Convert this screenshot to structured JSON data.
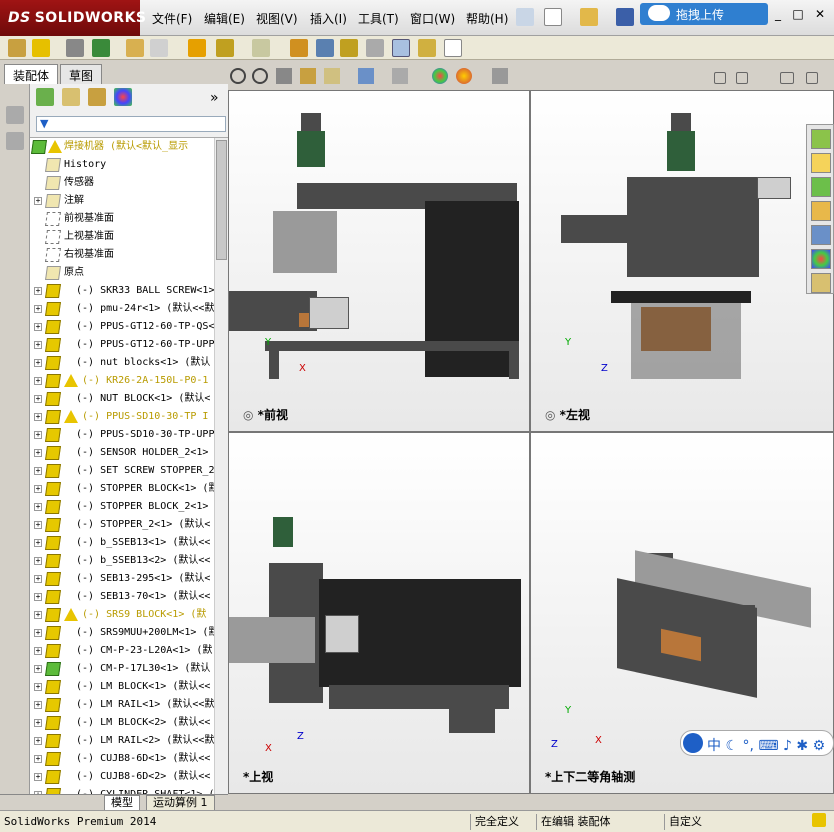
{
  "app": {
    "logo": "SOLIDWORKS",
    "logo_prefix": "DS"
  },
  "menu": [
    {
      "label": "文件(F)"
    },
    {
      "label": "编辑(E)"
    },
    {
      "label": "视图(V)"
    },
    {
      "label": "插入(I)"
    },
    {
      "label": "工具(T)"
    },
    {
      "label": "窗口(W)"
    },
    {
      "label": "帮助(H)"
    }
  ],
  "upload_label": "拖拽上传",
  "panel_tabs": [
    "装配体",
    "草图"
  ],
  "tree": {
    "root": "焊接机器  (默认<默认_显示",
    "nodes": [
      {
        "label": "History",
        "type": "history"
      },
      {
        "label": "传感器",
        "type": "sensor"
      },
      {
        "label": "注解",
        "type": "annot"
      },
      {
        "label": "前视基准面",
        "type": "plane"
      },
      {
        "label": "上视基准面",
        "type": "plane"
      },
      {
        "label": "右视基准面",
        "type": "plane"
      },
      {
        "label": "原点",
        "type": "origin"
      },
      {
        "label": "(-) SKR33 BALL SCREW<1>",
        "type": "part",
        "warn": false
      },
      {
        "label": "(-) pmu-24r<1> (默认<<默",
        "type": "part",
        "warn": false
      },
      {
        "label": "(-) PPUS-GT12-60-TP-QS<",
        "type": "part",
        "warn": false
      },
      {
        "label": "(-) PPUS-GT12-60-TP-UPPI",
        "type": "part",
        "warn": false
      },
      {
        "label": "(-) nut blocks<1> (默认",
        "type": "part",
        "warn": false
      },
      {
        "label": "(-) KR26-2A-150L-P0-1",
        "type": "part",
        "warn": true
      },
      {
        "label": "(-) NUT BLOCK<1> (默认<",
        "type": "part",
        "warn": false
      },
      {
        "label": "(-) PPUS-SD10-30-TP I",
        "type": "part",
        "warn": true
      },
      {
        "label": "(-) PPUS-SD10-30-TP-UPPI",
        "type": "part",
        "warn": false
      },
      {
        "label": "(-) SENSOR HOLDER_2<1>",
        "type": "part",
        "warn": false
      },
      {
        "label": "(-) SET SCREW STOPPER_2",
        "type": "part",
        "warn": false
      },
      {
        "label": "(-) STOPPER BLOCK<1> (默",
        "type": "part",
        "warn": false
      },
      {
        "label": "(-) STOPPER BLOCK_2<1>",
        "type": "part",
        "warn": false
      },
      {
        "label": "(-) STOPPER_2<1> (默认<",
        "type": "part",
        "warn": false
      },
      {
        "label": "(-) b_SSEB13<1> (默认<<",
        "type": "part",
        "warn": false
      },
      {
        "label": "(-) b_SSEB13<2> (默认<<",
        "type": "part",
        "warn": false
      },
      {
        "label": "(-) SEB13-295<1> (默认<",
        "type": "part",
        "warn": false
      },
      {
        "label": "(-) SEB13-70<1> (默认<<",
        "type": "part",
        "warn": false
      },
      {
        "label": "(-) SRS9 BLOCK<1> (默",
        "type": "part",
        "warn": true
      },
      {
        "label": "(-) SRS9MUU+200LM<1> (默",
        "type": "part",
        "warn": false
      },
      {
        "label": "(-) CM-P-23-L20A<1> (默",
        "type": "part",
        "warn": false
      },
      {
        "label": "(-) CM-P-17L30<1> (默认",
        "type": "partg",
        "warn": false
      },
      {
        "label": "(-) LM BLOCK<1> (默认<<",
        "type": "part",
        "warn": false
      },
      {
        "label": "(-) LM RAIL<1> (默认<<默",
        "type": "part",
        "warn": false
      },
      {
        "label": "(-) LM BLOCK<2> (默认<<",
        "type": "part",
        "warn": false
      },
      {
        "label": "(-) LM RAIL<2> (默认<<默",
        "type": "part",
        "warn": false
      },
      {
        "label": "(-) CUJB8-6D<1> (默认<<",
        "type": "part",
        "warn": false
      },
      {
        "label": "(-) CUJB8-6D<2> (默认<<",
        "type": "part",
        "warn": false
      },
      {
        "label": "(-) CYLINDER SHAFT<1> (",
        "type": "part",
        "warn": false
      }
    ]
  },
  "viewports": [
    {
      "label": "*前视",
      "axes": [
        "Y",
        "X"
      ]
    },
    {
      "label": "*左视",
      "axes": [
        "Y",
        "Z"
      ]
    },
    {
      "label": "*上视",
      "axes": [
        "X",
        "Z"
      ]
    },
    {
      "label": "*上下二等角轴测",
      "axes": [
        "Y",
        "X",
        "Z"
      ]
    }
  ],
  "ime": "中",
  "bottom_tabs": [
    "模型",
    "运动算例 1"
  ],
  "status": {
    "product": "SolidWorks Premium 2014",
    "s1": "完全定义",
    "s2": "在编辑 装配体",
    "s3": "自定义"
  },
  "colors": {
    "accent": "#2f7fd0",
    "warning": "#e8c400",
    "brand": "#a01414"
  }
}
